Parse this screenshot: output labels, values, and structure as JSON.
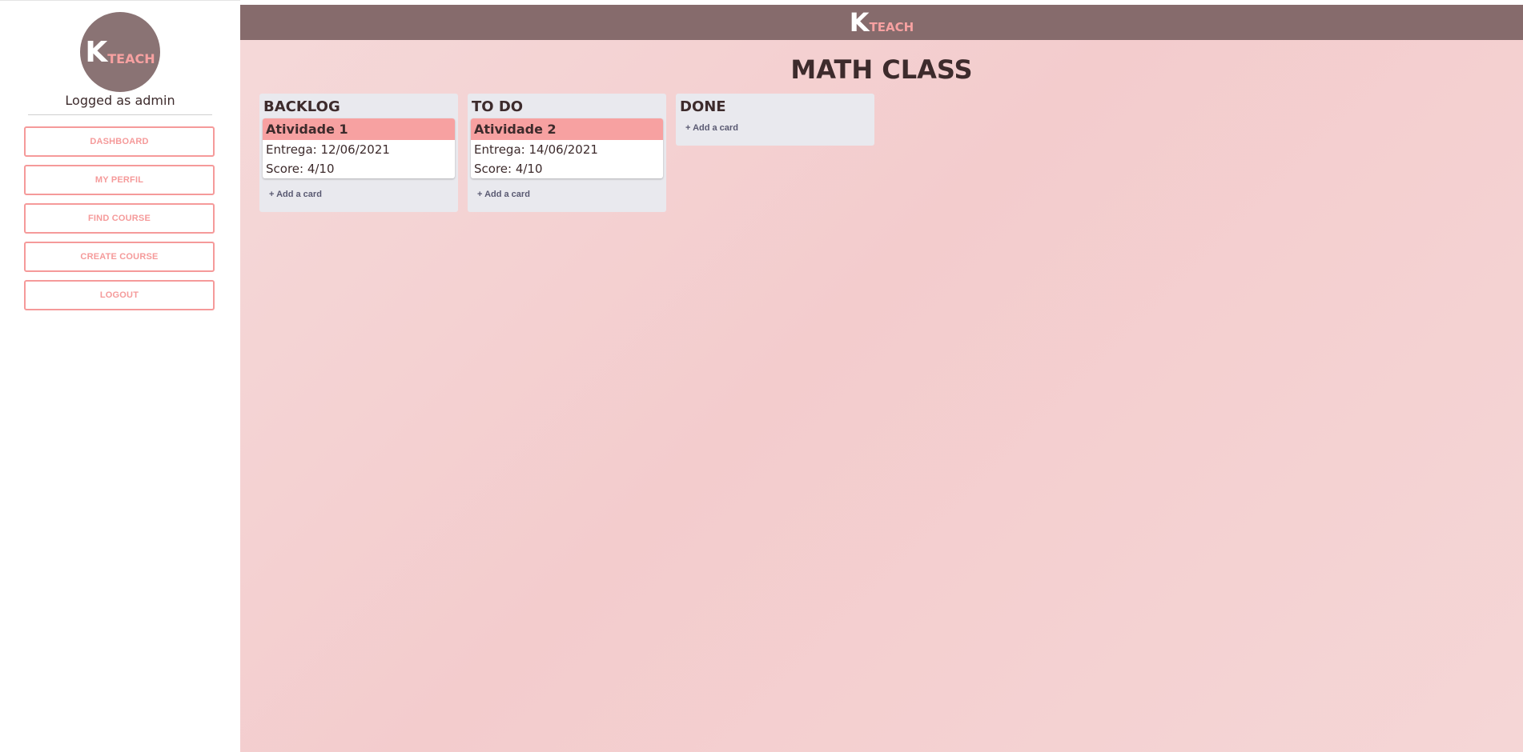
{
  "brand": {
    "k": "K",
    "teach": "TEACH"
  },
  "sidebar": {
    "logged_text": "Logged as admin",
    "items": [
      {
        "label": "DASHBOARD"
      },
      {
        "label": "MY PERFIL"
      },
      {
        "label": "FIND COURSE"
      },
      {
        "label": "CREATE COURSE"
      },
      {
        "label": "LOGOUT"
      }
    ]
  },
  "page": {
    "title": "MATH CLASS"
  },
  "board": {
    "add_card_label": "+ Add a card",
    "columns": [
      {
        "title": "BACKLOG",
        "cards": [
          {
            "title": "Atividade 1",
            "entrega": "Entrega: 12/06/2021",
            "score": "Score: 4/10"
          }
        ]
      },
      {
        "title": "TO DO",
        "cards": [
          {
            "title": "Atividade 2",
            "entrega": "Entrega: 14/06/2021",
            "score": "Score: 4/10"
          }
        ]
      },
      {
        "title": "DONE",
        "cards": []
      }
    ]
  },
  "colors": {
    "accent": "#f7a1a1",
    "topbar": "#866b6c",
    "avatar": "#8a7374",
    "text_dark": "#3d2b2c",
    "column_bg": "#e9e9ee"
  }
}
